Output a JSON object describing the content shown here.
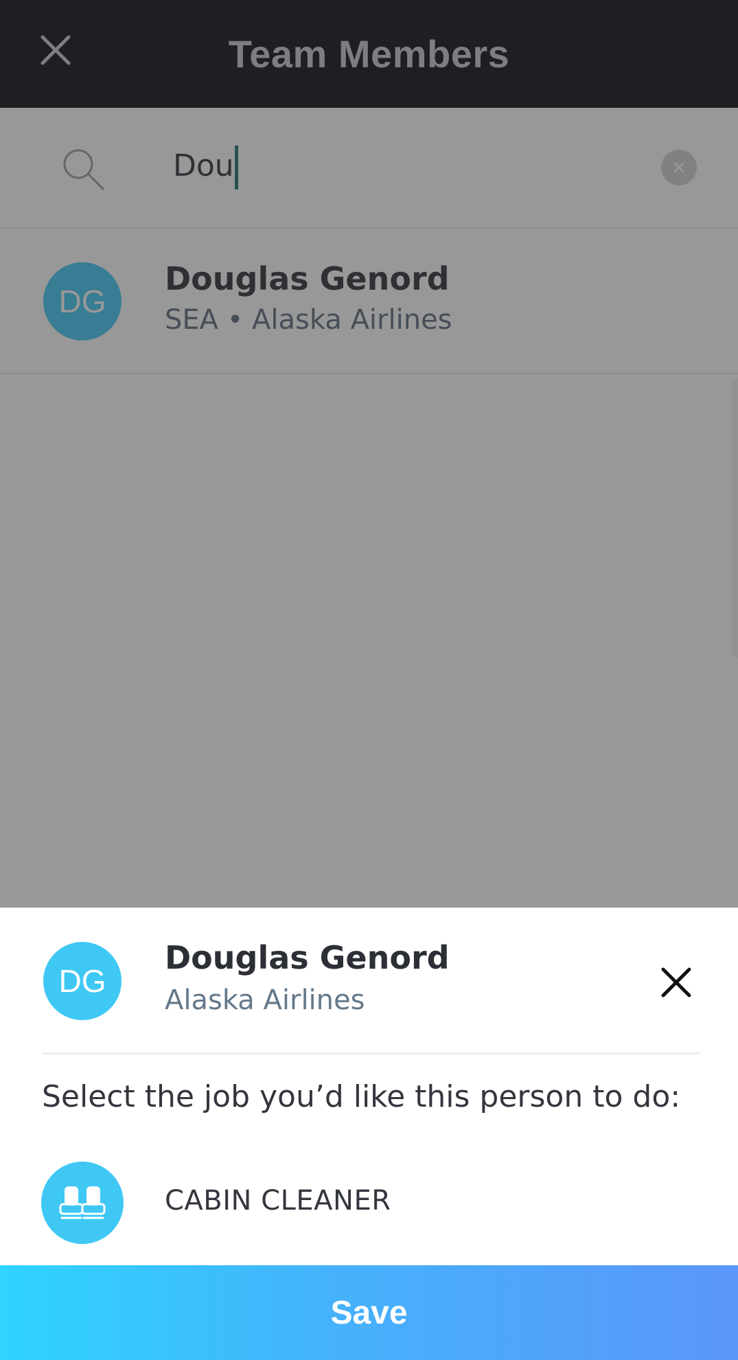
{
  "header": {
    "title": "Team Members",
    "close_icon": "close-icon"
  },
  "search": {
    "value": "Dou",
    "icon": "search-icon",
    "clear_icon": "clear-circle-icon"
  },
  "results": [
    {
      "initials": "DG",
      "name": "Douglas Genord",
      "subtitle": "SEA • Alaska Airlines"
    }
  ],
  "sheet": {
    "initials": "DG",
    "name": "Douglas Genord",
    "company": "Alaska Airlines",
    "prompt": "Select the job you’d like this person to do:",
    "job": {
      "label": "CABIN CLEANER",
      "icon": "seats-icon"
    },
    "save_label": "Save"
  },
  "colors": {
    "appbar": "#1e1f23",
    "accent": "#3fc8f4",
    "save_gradient_start": "#2fd4ff",
    "save_gradient_end": "#5b96fb"
  }
}
